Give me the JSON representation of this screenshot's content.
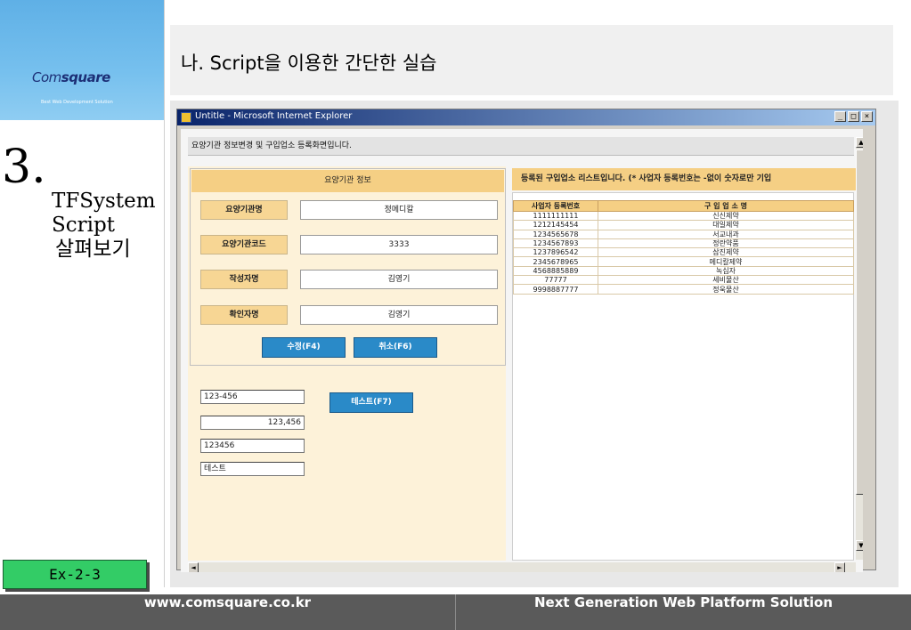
{
  "slide": {
    "logo": {
      "com": "Com",
      "square": "square",
      "tagline": "Best Web Development Solution"
    },
    "section_number": "3.",
    "section_title_lines": [
      "TFSystem",
      "Script",
      "살펴보기"
    ],
    "header_title": "나. Script을 이용한 간단한 실습",
    "ex_button": "Ex-2-3",
    "footer_left": "www.comsquare.co.kr",
    "footer_right": "Next Generation Web Platform Solution"
  },
  "browser": {
    "title": "Untitle - Microsoft Internet Explorer",
    "controls": [
      "_",
      "□",
      "×"
    ]
  },
  "page": {
    "header": "요양기관 정보변경 및 구입업소 등록화면입니다.",
    "info_title": "요양기관 정보",
    "fields": [
      {
        "label": "요양기관명",
        "value": "정메디칼"
      },
      {
        "label": "요양기관코드",
        "value": "3333"
      },
      {
        "label": "작성자명",
        "value": "김영기"
      },
      {
        "label": "확인자명",
        "value": "김영기"
      }
    ],
    "edit_button": "수정(F4)",
    "cancel_button": "취소(F6)",
    "test_button": "테스트(F7)",
    "test_inputs": [
      "123-456",
      "123,456",
      "123456",
      "테스트"
    ],
    "list_title": "등록된 구입업소 리스트입니다. (* 사업자 등록번호는 -없이 숫자로만 기입",
    "table_headers": [
      "사업자 등록번호",
      "구 입 업 소 명"
    ],
    "table_rows": [
      [
        "1111111111",
        "신신제약"
      ],
      [
        "1212145454",
        "대일제약"
      ],
      [
        "1234565678",
        "서교내과"
      ],
      [
        "1234567893",
        "정란약품"
      ],
      [
        "1237896542",
        "삼진제약"
      ],
      [
        "2345678965",
        "메디칼제약"
      ],
      [
        "4568885889",
        "녹십자"
      ],
      [
        "77777",
        "세비물산"
      ],
      [
        "9998887777",
        "정욱물산"
      ]
    ]
  },
  "colors": {
    "accent_green": "#33cc66",
    "button_blue": "#2a8ac8",
    "header_gold": "#f5cf84",
    "footer_gray": "#5a5a5a"
  }
}
